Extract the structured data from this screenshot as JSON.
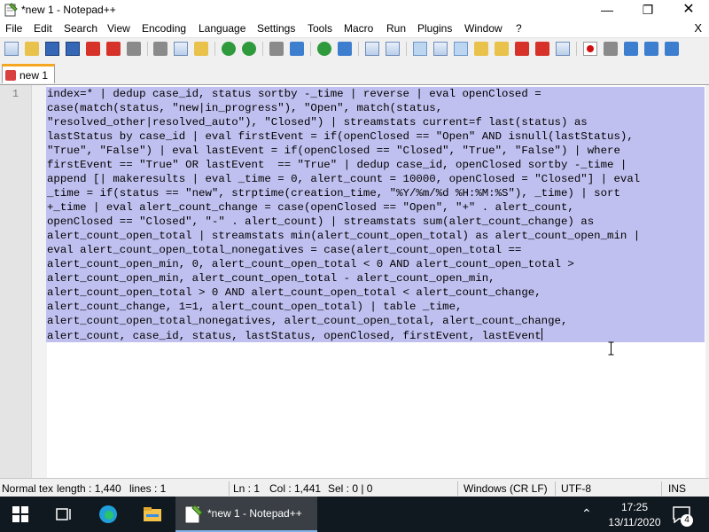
{
  "window": {
    "title": "*new 1 - Notepad++",
    "minimize": "—",
    "maximize": "❐",
    "close": "✕"
  },
  "menu": {
    "items": [
      "File",
      "Edit",
      "Search",
      "View",
      "Encoding",
      "Language",
      "Settings",
      "Tools",
      "Macro",
      "Run",
      "Plugins",
      "Window",
      "?"
    ],
    "close_doc": "X"
  },
  "tabs": [
    {
      "label": "new 1"
    }
  ],
  "editor": {
    "line_number": "1",
    "lines": [
      "index=* | dedup case_id, status sortby -_time | reverse | eval openClosed =",
      "case(match(status, \"new|in_progress\"), \"Open\", match(status,",
      "\"resolved_other|resolved_auto\"), \"Closed\") | streamstats current=f last(status) as",
      "lastStatus by case_id | eval firstEvent = if(openClosed == \"Open\" AND isnull(lastStatus),",
      "\"True\", \"False\") | eval lastEvent = if(openClosed == \"Closed\", \"True\", \"False\") | where",
      "firstEvent == \"True\" OR lastEvent  == \"True\" | dedup case_id, openClosed sortby -_time |",
      "append [| makeresults | eval _time = 0, alert_count = 10000, openClosed = \"Closed\"] | eval",
      "_time = if(status == \"new\", strptime(creation_time, \"%Y/%m/%d %H:%M:%S\"), _time) | sort",
      "+_time | eval alert_count_change = case(openClosed == \"Open\", \"+\" . alert_count,",
      "openClosed == \"Closed\", \"-\" . alert_count) | streamstats sum(alert_count_change) as",
      "alert_count_open_total | streamstats min(alert_count_open_total) as alert_count_open_min |",
      "eval alert_count_open_total_nonegatives = case(alert_count_open_total ==",
      "alert_count_open_min, 0, alert_count_open_total < 0 AND alert_count_open_total >",
      "alert_count_open_min, alert_count_open_total - alert_count_open_min,",
      "alert_count_open_total > 0 AND alert_count_open_total < alert_count_change,",
      "alert_count_change, 1=1, alert_count_open_total) | table _time,",
      "alert_count_open_total_nonegatives, alert_count_open_total, alert_count_change,",
      "alert_count, case_id, status, lastStatus, openClosed, firstEvent, lastEvent"
    ]
  },
  "status": {
    "lang": "Normal tex",
    "length": "length : 1,440",
    "lines": "lines : 1",
    "ln": "Ln : 1",
    "col": "Col : 1,441",
    "sel": "Sel : 0 | 0",
    "eol": "Windows (CR LF)",
    "encoding": "UTF-8",
    "mode": "INS"
  },
  "taskbar": {
    "active_app": "*new 1 - Notepad++",
    "time": "17:25",
    "date": "13/11/2020",
    "notifications": "4"
  }
}
